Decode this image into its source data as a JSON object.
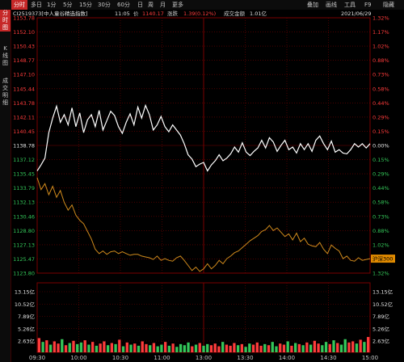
{
  "toolbar": {
    "tabs": [
      "分时",
      "多日",
      "1分",
      "5分",
      "15分",
      "30分",
      "60分",
      "日",
      "周",
      "月",
      "更多"
    ],
    "active_tab": "分时",
    "right_tools": [
      "叠加",
      "画线",
      "工具",
      "F9",
      "隐藏"
    ]
  },
  "sidebar": {
    "tabs": [
      "分\n时\n图",
      "K\n线\n图",
      "成\n交\n明\n细"
    ]
  },
  "info": {
    "code_name": "CI2519373[中人童谷精选指数]",
    "time": "11:05",
    "price_label": "价",
    "price": "1140.17",
    "change_label": "涨跌",
    "change": "1.39(0.12%)",
    "amount_label": "成交金额",
    "amount": "1.01亿",
    "date": "2021/06/29"
  },
  "colors": {
    "up": "#ff3b3b",
    "down": "#34c759",
    "neutral": "#e0e0e0",
    "grid": "#7a0000",
    "price_line": "#ffffff",
    "benchmark_line": "#d08a1c",
    "benchmark_label_bg": "#e08a00"
  },
  "chart_data": {
    "type": "line",
    "y_left_ticks": [
      "1153.78",
      "1152.10",
      "1150.43",
      "1148.77",
      "1147.10",
      "1145.44",
      "1143.78",
      "1142.11",
      "1140.45",
      "1138.78",
      "1137.12",
      "1135.45",
      "1133.79",
      "1132.13",
      "1130.46",
      "1128.80",
      "1127.13",
      "1125.47",
      "1123.80"
    ],
    "y_right_ticks": [
      "1.32%",
      "1.17%",
      "1.02%",
      "0.88%",
      "0.73%",
      "0.58%",
      "0.44%",
      "0.29%",
      "0.15%",
      "0.00%",
      "0.15%",
      "0.29%",
      "0.44%",
      "0.58%",
      "0.73%",
      "0.88%",
      "1.02%",
      "1.17%",
      "1.32%"
    ],
    "ylim": [
      1123.8,
      1153.78
    ],
    "prev_close": 1138.78,
    "x_ticks": [
      "09:30",
      "10:00",
      "10:30",
      "11:00",
      "13:00",
      "13:30",
      "14:00",
      "14:30",
      "15:00"
    ],
    "benchmark_label": "沪深300",
    "series": [
      {
        "name": "",
        "color": "#ffffff",
        "values": [
          1135.8,
          1136.5,
          1137.3,
          1140.3,
          1142.0,
          1143.4,
          1141.5,
          1142.4,
          1141.2,
          1143.2,
          1141.0,
          1142.6,
          1140.3,
          1141.8,
          1142.4,
          1141.0,
          1142.9,
          1140.6,
          1141.7,
          1142.8,
          1142.3,
          1141.0,
          1140.2,
          1141.5,
          1142.5,
          1141.2,
          1143.3,
          1142.0,
          1143.5,
          1142.4,
          1140.6,
          1141.2,
          1142.2,
          1141.0,
          1140.4,
          1141.2,
          1140.6,
          1140.0,
          1139.0,
          1137.7,
          1137.2,
          1136.3,
          1136.6,
          1136.8,
          1135.8,
          1136.5,
          1137.0,
          1137.7,
          1137.0,
          1137.3,
          1137.8,
          1138.6,
          1138.0,
          1139.1,
          1138.0,
          1137.6,
          1138.1,
          1138.5,
          1139.4,
          1138.5,
          1139.7,
          1139.2,
          1138.1,
          1138.8,
          1139.4,
          1138.3,
          1138.6,
          1137.9,
          1139.0,
          1138.3,
          1139.0,
          1138.1,
          1139.4,
          1139.9,
          1139.0,
          1138.3,
          1139.3,
          1138.0,
          1138.3,
          1137.9,
          1137.8,
          1138.3,
          1139.0,
          1138.6,
          1139.0,
          1138.5,
          1139.0
        ]
      },
      {
        "name": "沪深300",
        "color": "#d08a1c",
        "values": [
          1135.0,
          1133.6,
          1134.3,
          1133.0,
          1134.0,
          1132.7,
          1133.5,
          1132.1,
          1131.2,
          1131.8,
          1130.6,
          1130.0,
          1129.6,
          1128.7,
          1127.8,
          1126.6,
          1126.1,
          1126.4,
          1126.0,
          1126.3,
          1126.4,
          1126.1,
          1126.3,
          1126.1,
          1125.9,
          1126.0,
          1126.0,
          1125.8,
          1125.7,
          1125.6,
          1125.4,
          1125.8,
          1125.3,
          1125.5,
          1125.3,
          1125.2,
          1125.6,
          1125.8,
          1125.3,
          1124.7,
          1124.1,
          1124.5,
          1124.0,
          1124.3,
          1124.9,
          1124.3,
          1124.7,
          1125.3,
          1124.9,
          1125.5,
          1125.8,
          1126.2,
          1126.4,
          1126.8,
          1127.2,
          1127.6,
          1127.9,
          1128.2,
          1128.7,
          1128.9,
          1129.4,
          1128.8,
          1129.1,
          1128.6,
          1128.1,
          1128.4,
          1127.7,
          1128.5,
          1127.5,
          1127.9,
          1127.2,
          1127.0,
          1126.9,
          1127.4,
          1126.6,
          1126.1,
          1127.1,
          1126.7,
          1126.4,
          1125.5,
          1125.8,
          1125.3,
          1125.2,
          1125.6,
          1125.3,
          1125.4,
          1125.5
        ]
      }
    ],
    "volume": {
      "y_ticks": [
        "13.15亿",
        "10.52亿",
        "7.89亿",
        "5.26亿",
        "2.63亿"
      ],
      "ylim": [
        0,
        13.15
      ],
      "unit": "亿",
      "values": [
        2.6,
        1.9,
        2.2,
        1.4,
        2.0,
        1.6,
        2.4,
        1.3,
        1.7,
        2.1,
        1.5,
        1.8,
        2.2,
        1.4,
        1.9,
        1.2,
        1.6,
        2.0,
        1.3,
        1.7,
        1.5,
        2.3,
        1.1,
        1.8,
        1.4,
        1.6,
        1.2,
        2.0,
        1.5,
        1.3,
        1.7,
        1.1,
        1.4,
        1.9,
        1.2,
        1.6,
        1.0,
        1.5,
        1.3,
        1.8,
        1.1,
        1.4,
        1.7,
        1.2,
        1.5,
        1.3,
        1.6,
        1.1,
        1.9,
        1.4,
        1.2,
        1.7,
        1.3,
        1.5,
        1.0,
        1.6,
        1.4,
        1.8,
        1.2,
        1.5,
        1.3,
        1.9,
        1.1,
        1.6,
        1.4,
        2.0,
        1.2,
        1.7,
        1.5,
        1.3,
        1.8,
        1.4,
        2.1,
        1.6,
        1.3,
        1.9,
        1.5,
        2.2,
        1.7,
        1.4,
        2.4,
        1.8,
        2.0,
        1.6,
        2.3,
        1.9,
        2.8
      ],
      "directions": [
        "up",
        "down",
        "up",
        "down",
        "up",
        "up",
        "down",
        "up",
        "down",
        "up",
        "down",
        "down",
        "up",
        "down",
        "up",
        "down",
        "up",
        "up",
        "down",
        "up",
        "down",
        "up",
        "down",
        "up",
        "down",
        "up",
        "down",
        "up",
        "up",
        "down",
        "up",
        "down",
        "down",
        "up",
        "down",
        "up",
        "down",
        "down",
        "down",
        "down",
        "up",
        "down",
        "up",
        "down",
        "down",
        "up",
        "up",
        "up",
        "down",
        "up",
        "up",
        "up",
        "down",
        "up",
        "down",
        "down",
        "up",
        "up",
        "up",
        "down",
        "up",
        "down",
        "down",
        "up",
        "up",
        "down",
        "up",
        "down",
        "up",
        "down",
        "up",
        "down",
        "up",
        "up",
        "down",
        "down",
        "up",
        "down",
        "up",
        "down",
        "down",
        "up",
        "up",
        "down",
        "up",
        "down",
        "up"
      ]
    }
  }
}
